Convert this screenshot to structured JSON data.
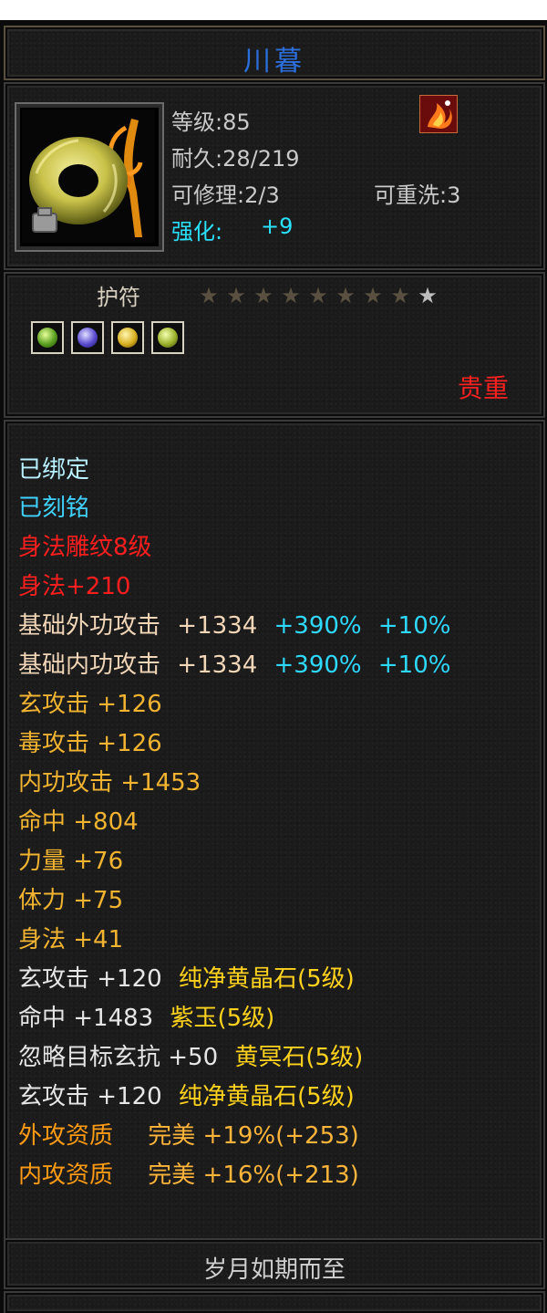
{
  "title": "川暮",
  "info": {
    "level": "等级:85",
    "durability": "耐久:28/219",
    "repair": "可修理:2/3",
    "rewash": "可重洗:3",
    "enhance_label": "强化:",
    "enhance_value": "+9",
    "icon": "jade-ring-amulet-icon",
    "badge_icon": "flame-emblem-icon"
  },
  "stars_row": {
    "type_label": "护符",
    "stars_filled": 8,
    "stars_total": 9,
    "gems": [
      "green-gem-icon",
      "purple-gem-icon",
      "yellow-gem-icon",
      "green-gem-icon"
    ],
    "rarity": "贵重"
  },
  "attributes": {
    "bound": "已绑定",
    "engraved": "已刻铭",
    "carving": "身法雕纹8级",
    "carving_bonus": "身法+210",
    "ext_atk_label": "基础外功攻击",
    "ext_atk_value": "+1334",
    "ext_atk_pct": "+390%",
    "ext_atk_pct2": "+10%",
    "int_atk_label": "基础内功攻击",
    "int_atk_value": "+1334",
    "int_atk_pct": "+390%",
    "int_atk_pct2": "+10%",
    "mystic_atk": "玄攻击 +126",
    "poison_atk": "毒攻击 +126",
    "inner_atk": "内功攻击 +1453",
    "hit": "命中 +804",
    "strength": "力量 +76",
    "stamina": "体力 +75",
    "agility": "身法 +41",
    "gem1_stat": "玄攻击 +120",
    "gem1_name": "纯净黄晶石(5级)",
    "gem2_stat": "命中 +1483",
    "gem2_name": "紫玉(5级)",
    "gem3_stat": "忽略目标玄抗 +50",
    "gem3_name": "黄冥石(5级)",
    "gem4_stat": "玄攻击 +120",
    "gem4_name": "纯净黄晶石(5级)",
    "ext_quality_label": "外攻资质",
    "ext_quality_value": "完美 +19%(+253)",
    "int_quality_label": "内攻资质",
    "int_quality_value": "完美 +16%(+213)"
  },
  "footer": "岁月如期而至",
  "colors": {
    "title": "#2b6fdc",
    "rarity": "#ff2020",
    "background": "#1b1b1b"
  }
}
